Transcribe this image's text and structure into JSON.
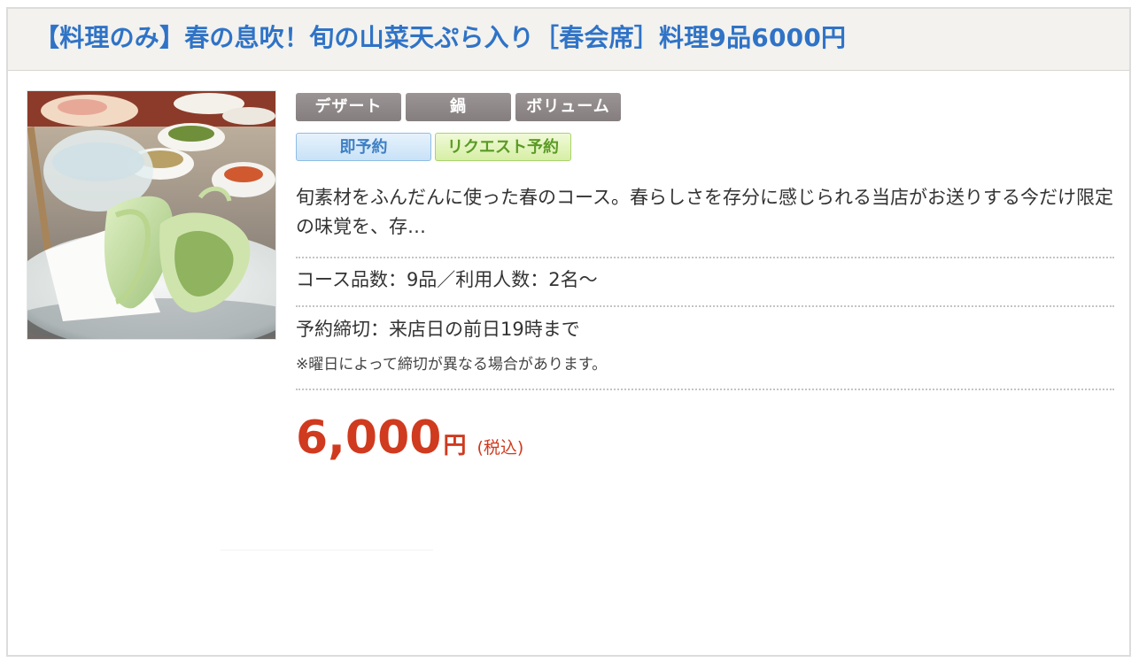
{
  "course": {
    "title": "【料理のみ】春の息吹！旬の山菜天ぷら入り［春会席］料理9品6000円",
    "photo_alt": "",
    "tags": [
      "デザート",
      "鍋",
      "ボリューム"
    ],
    "reservation": {
      "instant_label": "即予約",
      "request_label": "リクエスト予約"
    },
    "description": "旬素材をふんだんに使った春のコース。春らしさを存分に感じられる当店がお送りする今だけ限定の味覚を、存…",
    "info_line": "コース品数：9品／利用人数：2名～",
    "deadline": "予約締切：来店日の前日19時まで",
    "deadline_note": "※曜日によって締切が異なる場合があります。",
    "price": {
      "amount": "6,000",
      "unit": "円",
      "tax": "(税込)"
    }
  },
  "colors": {
    "title_blue": "#2f73c7",
    "price_red": "#d03a1e",
    "tag_gray": "#8e8788",
    "instant_blue": "#c9e2f7",
    "request_green": "#d6efa5",
    "header_bg": "#f3f2ee"
  }
}
